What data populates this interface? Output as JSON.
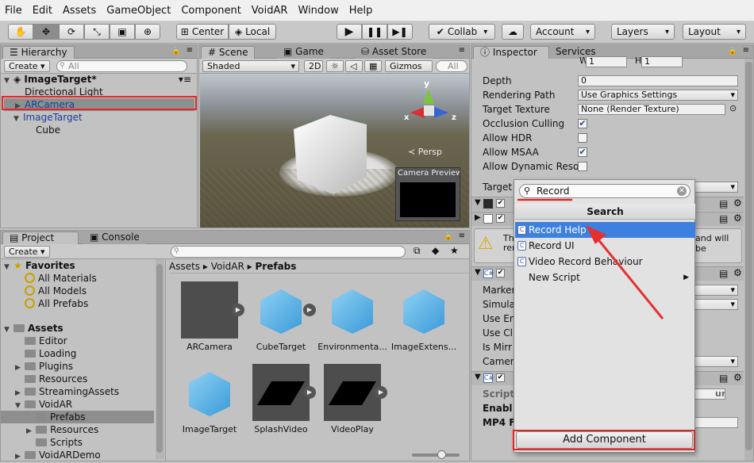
{
  "menu": [
    "File",
    "Edit",
    "Assets",
    "GameObject",
    "Component",
    "VoidAR",
    "Window",
    "Help"
  ],
  "toolbar": {
    "pivot": "Center",
    "space": "Local",
    "collab": "Collab",
    "account": "Account",
    "layers": "Layers",
    "layout": "Layout"
  },
  "hierarchy": {
    "tab": "Hierarchy",
    "create": "Create",
    "search_placeholder": "All",
    "items": [
      "ImageTarget*",
      "Directional Light",
      "ARCamera",
      "ImageTarget",
      "Cube"
    ]
  },
  "scene": {
    "tabs": [
      "Scene",
      "Game",
      "Asset Store"
    ],
    "shading": "Shaded",
    "mode2d": "2D",
    "gizmos": "Gizmos",
    "search_placeholder": "All",
    "persp": "Persp",
    "axis_y": "y",
    "axis_x": "x",
    "axis_z": "z",
    "camera_preview": "Camera Preview"
  },
  "project": {
    "tabs": [
      "Project",
      "Console"
    ],
    "create": "Create",
    "favorites": "Favorites",
    "favorite_items": [
      "All Materials",
      "All Models",
      "All Prefabs"
    ],
    "assets": "Assets",
    "folders": [
      "Editor",
      "Loading",
      "Plugins",
      "Resources",
      "StreamingAssets",
      "VoidAR",
      "Prefabs",
      "Resources",
      "Scripts",
      "VoidARDemo"
    ],
    "breadcrumb": [
      "Assets",
      "VoidAR",
      "Prefabs"
    ],
    "prefabs": [
      "ARCamera",
      "CubeTarget",
      "Environmenta...",
      "ImageExtens...",
      "ImageTarget",
      "SplashVideo",
      "VideoPlay"
    ]
  },
  "inspector": {
    "tabs": [
      "Inspector",
      "Services"
    ],
    "w_label": "W",
    "w_value": "1",
    "h_label": "H",
    "h_value": "1",
    "depth_label": "Depth",
    "depth_value": "0",
    "rendering_path_label": "Rendering Path",
    "rendering_path_value": "Use Graphics Settings",
    "target_texture_label": "Target Texture",
    "target_texture_value": "None (Render Texture)",
    "occlusion_label": "Occlusion Culling",
    "hdr_label": "Allow HDR",
    "msaa_label": "Allow MSAA",
    "dynres_label": "Allow Dynamic Reso",
    "target_label": "Target",
    "info_text_left": "Th",
    "info_text_left2": "rer",
    "info_text_right": "and will be",
    "marker_label": "Marker",
    "simul_label": "Simulat",
    "use_en_label": "Use En",
    "use_cl_label": "Use Cl",
    "is_mirr_label": "Is Mirr",
    "camer_label": "Camer",
    "script_label": "Script",
    "script_value": "ur",
    "enable_label": "Enabl",
    "mp4_label": "MP4 F"
  },
  "popup": {
    "search_value": "Record",
    "header": "Search",
    "items": [
      "Record Help",
      "Record UI",
      "Video Record Behaviour",
      "New Script"
    ],
    "add_component": "Add Component"
  }
}
